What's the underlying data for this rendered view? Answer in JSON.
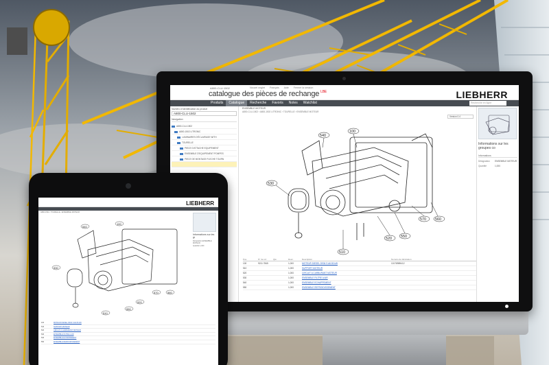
{
  "app": {
    "code": "A800-CLU-1502",
    "title": "catalogue des pièces de rechange",
    "title_badge": "LBE",
    "brand": "LIEBHERR",
    "top_links": [
      "Nouvel onglet",
      "Français",
      "Aide",
      "Fermer la session"
    ]
  },
  "nav": {
    "items": [
      "Produits",
      "Catalogue",
      "Recherche",
      "Favoris",
      "Notes",
      "Watchlist"
    ],
    "active_index": 1,
    "search_placeholder": "Recherche en ligne"
  },
  "left_pane": {
    "id_label": "Numéro d'identification du produit",
    "id_value": "A800-CLU-1502",
    "navigation_label": "Navigation",
    "tree": [
      "A800-CLU-1502",
      "A800-1502 LITRONIC",
      "LUMINAIRES D'ÉCLAIRAGE WITH",
      "TOURELLE",
      "PIECE D'ATTACHE EQUIPEMENT",
      "ENSEMBLE D'EQUIPEMENT POMPES",
      "PIECE DE MONTAGE FLECHE TOURN"
    ],
    "highlight_index": 7
  },
  "main": {
    "title": "ENSEMBLE MOTEUR",
    "breadcrumb": "A800-CLU-1502 › A800-1502 LITRONIC › TOURELLE › ENSEMBLE MOTEUR",
    "version_select": "Version 0.4",
    "callouts": [
      "540",
      "100",
      "530",
      "510",
      "520",
      "550",
      "560",
      "570"
    ],
    "parts_headers": [
      "Pos.",
      "N° de ref.",
      "Qté",
      "Desc.",
      "Description",
      "Numéro de fabrication"
    ],
    "parts": [
      {
        "pos": "100",
        "ref": "9211 7845",
        "qty": "1,000",
        "desc": "MOTEUR DIESEL D934 S A6 80 kW",
        "mfg": "10178989412"
      },
      {
        "pos": "510",
        "ref": "",
        "qty": "1,000",
        "desc": "SUPPORT MOTEUR",
        "mfg": ""
      },
      {
        "pos": "520",
        "ref": "",
        "qty": "1,000",
        "desc": "CIRCUIT A CARBURANT MOTEUR",
        "mfg": ""
      },
      {
        "pos": "530",
        "ref": "",
        "qty": "1,000",
        "desc": "ENSEMBLE FILTRE A AIR",
        "mfg": ""
      },
      {
        "pos": "540",
        "ref": "",
        "qty": "1,000",
        "desc": "ENSEMBLE ECHAPPEMENT",
        "mfg": ""
      },
      {
        "pos": "550",
        "ref": "",
        "qty": "1,000",
        "desc": "ENSEMBLE REFROIDISSEMENT",
        "mfg": ""
      }
    ]
  },
  "right_pane": {
    "info_title": "Informations sur les groupes co",
    "info_sub": "Informations",
    "kv": [
      {
        "k": "Désignation",
        "v": "ENSEMBLE MOTEUR"
      },
      {
        "k": "Quantité",
        "v": "1,000"
      }
    ]
  },
  "tablet": {
    "brand": "LIEBHERR",
    "crumb": "A800-1502 › TOURELLE › ENSEMBLE MOTEUR",
    "info_title": "Informations sur les gr",
    "kv": [
      "Désignation  ENSEMBLE MOTEUR",
      "Quantité  1,000"
    ],
    "callouts": [
      "540",
      "100",
      "530",
      "510",
      "520",
      "550",
      "560",
      "570"
    ],
    "parts": [
      {
        "pos": "100",
        "desc": "MOTEUR DIESEL D934 S A6 80 kW"
      },
      {
        "pos": "510",
        "desc": "SUPPORT MOTEUR"
      },
      {
        "pos": "520",
        "desc": "CIRCUIT A CARBURANT MOTEUR"
      },
      {
        "pos": "530",
        "desc": "ENSEMBLE FILTRE A AIR"
      },
      {
        "pos": "540",
        "desc": "ENSEMBLE ECHAPPEMENT"
      },
      {
        "pos": "550",
        "desc": "ENSEMBLE REFROIDISSEMENT"
      }
    ]
  },
  "colors": {
    "brand_red": "#e30613",
    "nav_bg": "#474c52",
    "crane_yellow": "#f2b800",
    "link": "#2a63c5",
    "highlight": "#fdf2b8"
  }
}
